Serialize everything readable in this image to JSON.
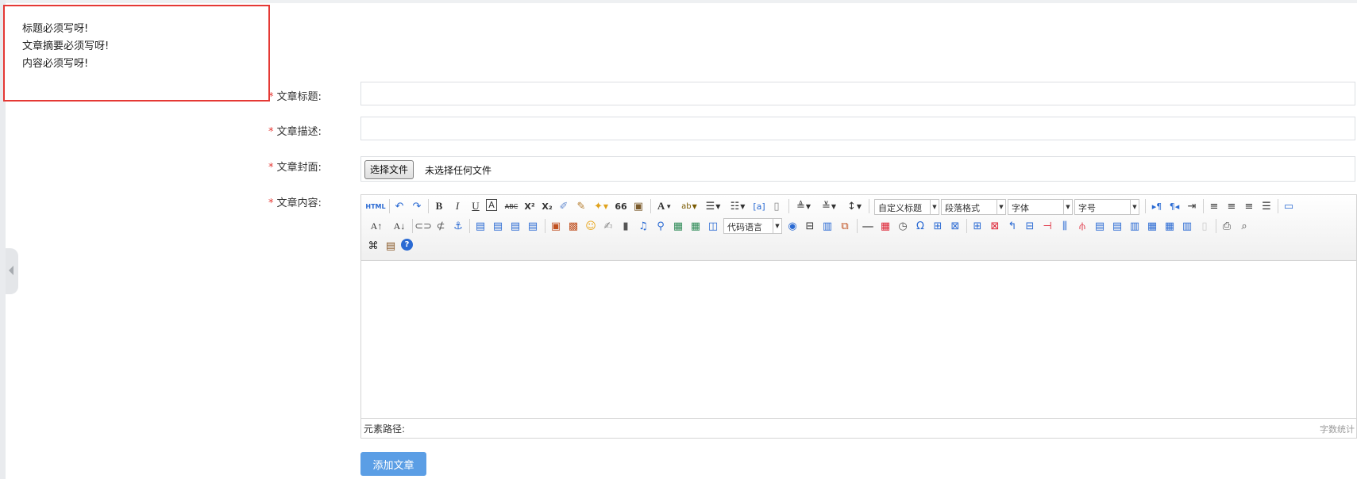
{
  "errors": [
    "标题必须写呀!",
    "文章摘要必须写呀!",
    "内容必须写呀!"
  ],
  "form": {
    "required_mark": "*",
    "title_label": "文章标题:",
    "desc_label": "文章描述:",
    "cover_label": "文章封面:",
    "content_label": "文章内容:",
    "title_value": "",
    "desc_value": "",
    "file_button": "选择文件",
    "file_status": "未选择任何文件",
    "submit_label": "添加文章"
  },
  "editor": {
    "combos": {
      "custom_heading": "自定义标题",
      "paragraph_format": "段落格式",
      "font_family": "字体",
      "font_size": "字号",
      "code_language": "代码语言"
    },
    "status_path_label": "元素路径:",
    "word_count_label": "字数统计",
    "toolbar_glyphs": {
      "html": "HTML",
      "bold": "B",
      "italic": "I",
      "underline": "U",
      "boxed_a": "A",
      "strike": "ABC",
      "superscript": "X²",
      "subscript": "X₂",
      "quote": "66",
      "font_color": "A",
      "highlight": "ab",
      "omega": "Ω"
    }
  }
}
